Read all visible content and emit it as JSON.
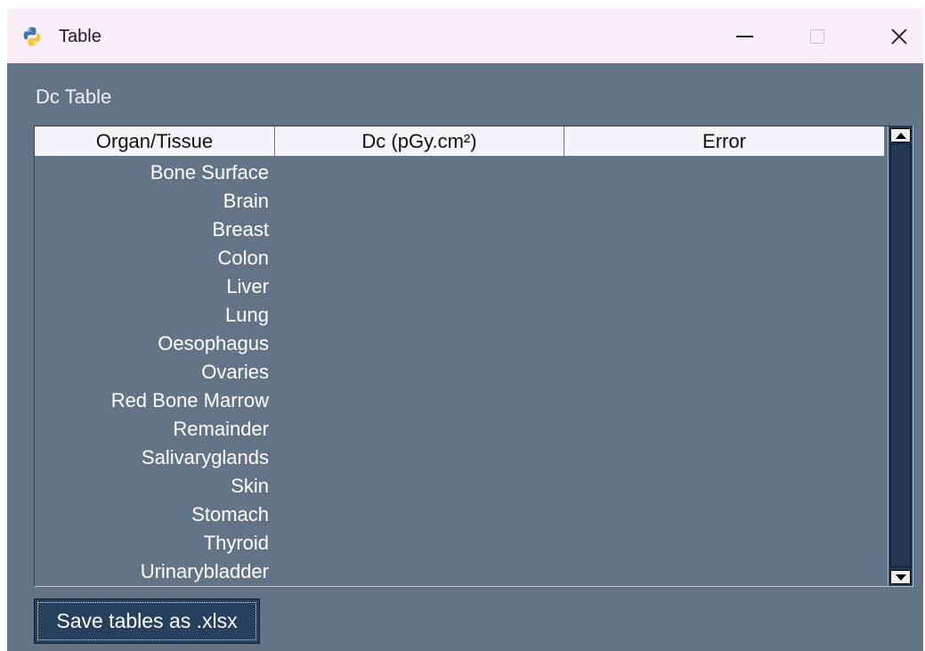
{
  "window": {
    "title": "Table",
    "icon": "python-icon"
  },
  "panel": {
    "title": "Dc Table"
  },
  "table": {
    "columns": [
      "Organ/Tissue",
      "Dc (pGy.cm²)",
      "Error"
    ],
    "rows": [
      "Bone Surface",
      "Brain",
      "Breast",
      "Colon",
      "Liver",
      "Lung",
      "Oesophagus",
      "Ovaries",
      "Red Bone Marrow",
      "Remainder",
      "Salivaryglands",
      "Skin",
      "Stomach",
      "Thyroid",
      "Urinarybladder"
    ]
  },
  "buttons": {
    "save_label": "Save tables as .xlsx"
  },
  "colors": {
    "background": "#647487",
    "titlebar": "#f7eef7",
    "scrollbar": "#233853",
    "button": "#26405e"
  }
}
